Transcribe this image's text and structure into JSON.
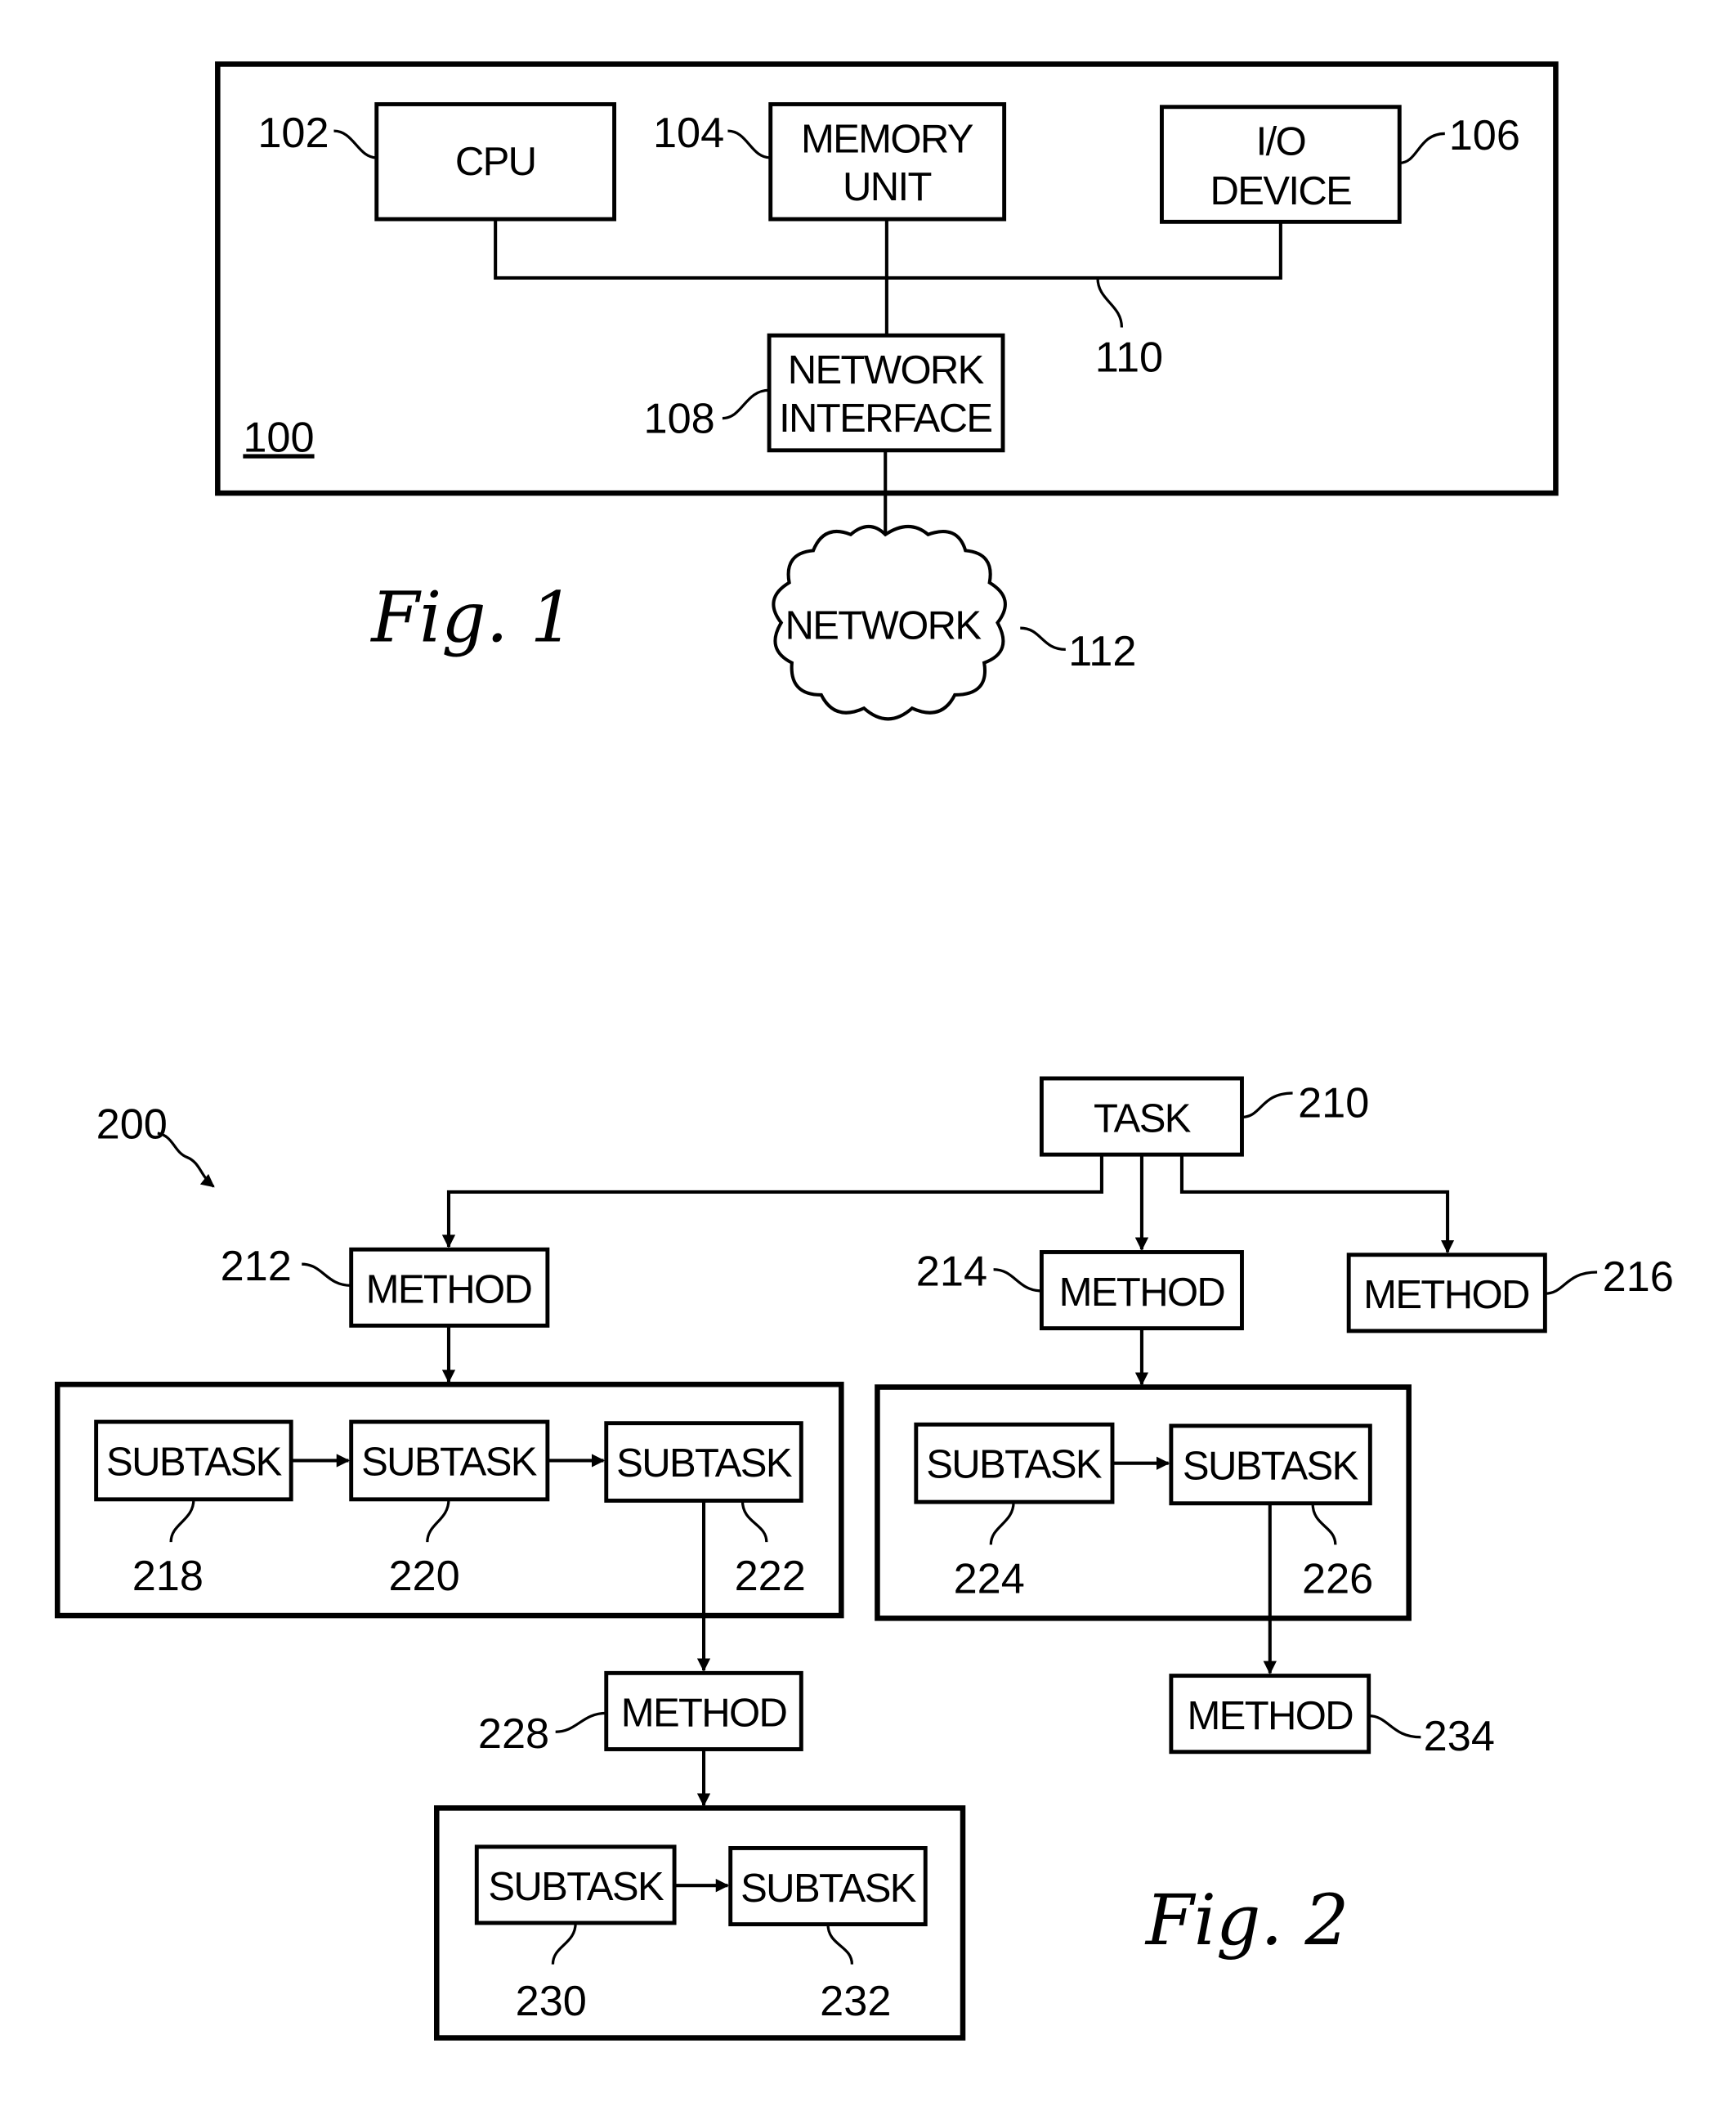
{
  "figure1": {
    "caption": "Fig. 1",
    "system_ref": "100",
    "cpu": {
      "label": "CPU",
      "ref": "102"
    },
    "memory": {
      "label_line1": "MEMORY",
      "label_line2": "UNIT",
      "ref": "104"
    },
    "io": {
      "label_line1": "I/O",
      "label_line2": "DEVICE",
      "ref": "106"
    },
    "netif": {
      "label_line1": "NETWORK",
      "label_line2": "INTERFACE",
      "ref": "108"
    },
    "bus_ref": "110",
    "network": {
      "label": "NETWORK",
      "ref": "112"
    }
  },
  "figure2": {
    "caption": "Fig. 2",
    "diagram_ref": "200",
    "task": {
      "label": "TASK",
      "ref": "210"
    },
    "method_212": {
      "label": "METHOD",
      "ref": "212"
    },
    "method_214": {
      "label": "METHOD",
      "ref": "214"
    },
    "method_216": {
      "label": "METHOD",
      "ref": "216"
    },
    "subtask_218": {
      "label": "SUBTASK",
      "ref": "218"
    },
    "subtask_220": {
      "label": "SUBTASK",
      "ref": "220"
    },
    "subtask_222": {
      "label": "SUBTASK",
      "ref": "222"
    },
    "subtask_224": {
      "label": "SUBTASK",
      "ref": "224"
    },
    "subtask_226": {
      "label": "SUBTASK",
      "ref": "226"
    },
    "method_228": {
      "label": "METHOD",
      "ref": "228"
    },
    "method_234": {
      "label": "METHOD",
      "ref": "234"
    },
    "subtask_230": {
      "label": "SUBTASK",
      "ref": "230"
    },
    "subtask_232": {
      "label": "SUBTASK",
      "ref": "232"
    }
  }
}
